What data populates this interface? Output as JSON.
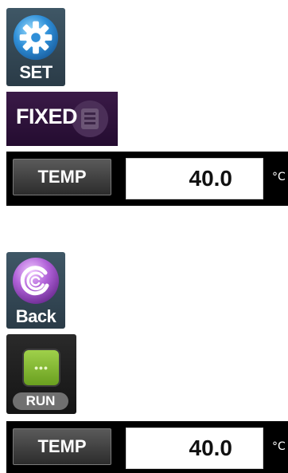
{
  "set_button": {
    "label": "SET",
    "icon": "gear-icon"
  },
  "mode_button": {
    "label": "FIXED",
    "icon": "document-icon"
  },
  "temp_rows": [
    {
      "key_label": "TEMP",
      "value": "40.0",
      "unit": "°C"
    },
    {
      "key_label": "TEMP",
      "value": "40.0",
      "unit": "°C"
    }
  ],
  "back_button": {
    "label": "Back",
    "icon": "swirl-logo-icon"
  },
  "run_button": {
    "label": "RUN",
    "icon": "run-icon",
    "icon_text": "•••"
  },
  "colors": {
    "set_bg": "#3f5766",
    "fixed_bg": "#3a1a47",
    "temp_bar": "#000000",
    "run_icon_green": "#8cc43a",
    "back_logo_purple": "#9b59c6"
  }
}
